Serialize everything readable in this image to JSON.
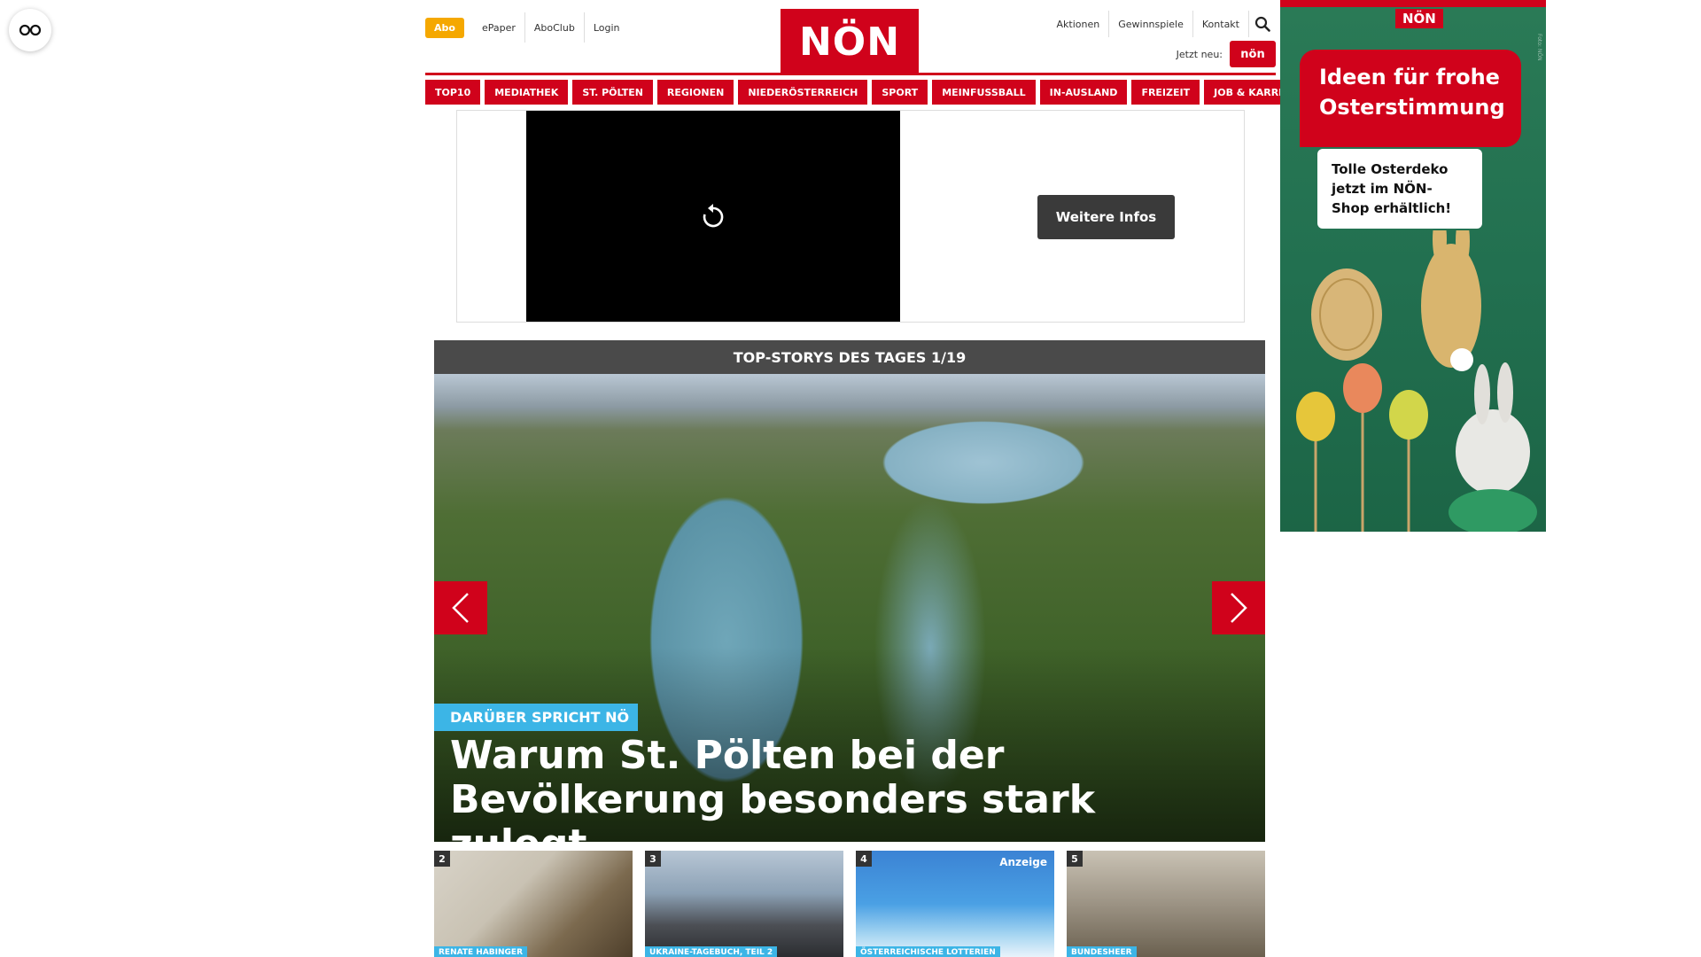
{
  "utility": {
    "abo": "Abo",
    "epaper": "ePaper",
    "aboclub": "AboClub",
    "login": "Login",
    "aktionen": "Aktionen",
    "gewinnspiele": "Gewinnspiele",
    "kontakt": "Kontakt",
    "jetzt_neu": "Jetzt neu:",
    "jetzt_badge": "nön"
  },
  "logo": "NÖN",
  "nav": [
    "TOP10",
    "MEDIATHEK",
    "ST. PÖLTEN",
    "REGIONEN",
    "NIEDERÖSTERREICH",
    "SPORT",
    "MEINFUSSBALL",
    "IN-AUSLAND",
    "FREIZEIT",
    "JOB & KARRIERE"
  ],
  "ad": {
    "button": "Weitere Infos"
  },
  "top_stories": {
    "header": "TOP-STORYS DES TAGES 1/19",
    "hero_tag": "DARÜBER SPRICHT NÖ",
    "hero_title": "Warum St. Pölten bei der Bevölkerung besonders stark zulegt"
  },
  "thumbs": [
    {
      "num": "2",
      "tag": "RENATE HABINGER",
      "badge": ""
    },
    {
      "num": "3",
      "tag": "UKRAINE-TAGEBUCH, TEIL 2",
      "badge": ""
    },
    {
      "num": "4",
      "tag": "ÖSTERREICHISCHE LOTTERIEN",
      "badge": "Anzeige"
    },
    {
      "num": "5",
      "tag": "BUNDESHEER",
      "badge": ""
    }
  ],
  "side_ad": {
    "logo": "NÖN",
    "headline": "Ideen für frohe Osterstimmung",
    "body": "Tolle Osterdeko jetzt im NÖN-Shop erhältlich!",
    "credit": "Foto: NÖN"
  },
  "colors": {
    "brand_red": "#d0021b",
    "abo_orange": "#f5a800",
    "tag_blue": "#3cb5e6"
  }
}
